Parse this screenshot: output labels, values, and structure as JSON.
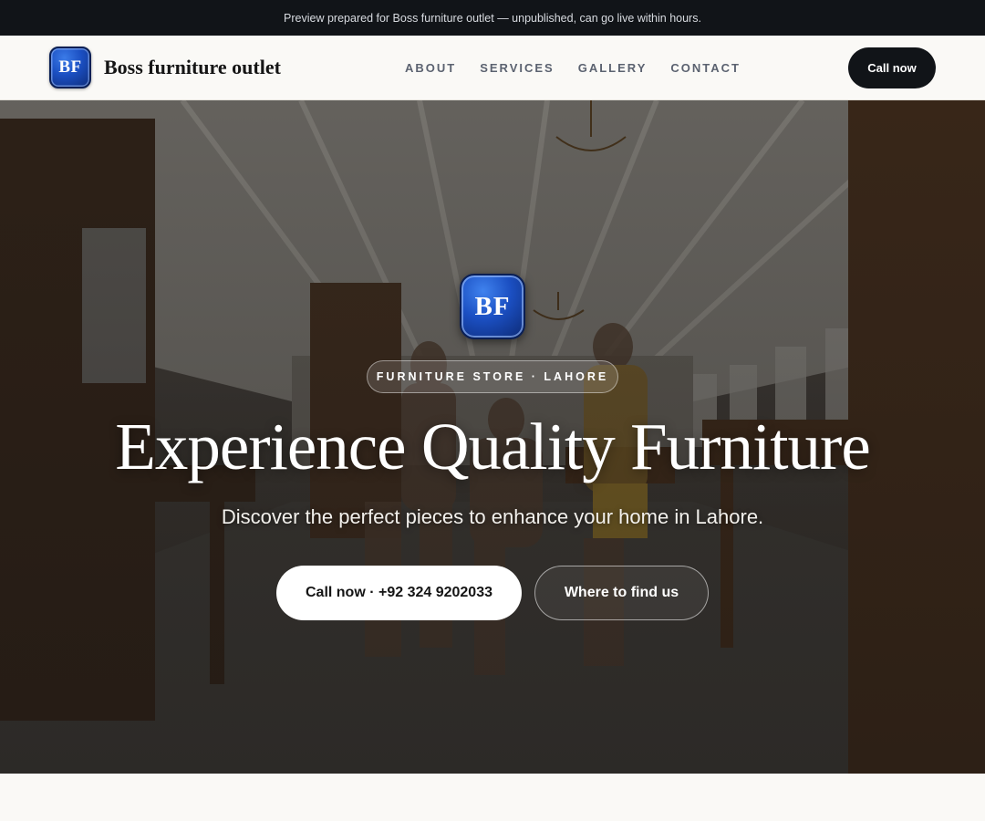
{
  "banner": {
    "text": "Preview prepared for Boss furniture outlet — unpublished, can go live within hours."
  },
  "header": {
    "logo_text": "BF",
    "brand_name": "Boss furniture outlet",
    "nav": [
      {
        "label": "ABOUT"
      },
      {
        "label": "SERVICES"
      },
      {
        "label": "GALLERY"
      },
      {
        "label": "CONTACT"
      }
    ],
    "cta_label": "Call now"
  },
  "hero": {
    "logo_text": "BF",
    "kicker": "FURNITURE STORE · LAHORE",
    "title": "Experience Quality Furniture",
    "subtitle": "Discover the perfect pieces to enhance your home in Lahore.",
    "primary_button": "Call now · +92 324 9202033",
    "secondary_button": "Where to find us"
  },
  "colors": {
    "banner_bg": "#111418",
    "accent_dark": "#111418",
    "logo_blue": "#1b4fc2",
    "page_bg": "#faf9f6"
  }
}
